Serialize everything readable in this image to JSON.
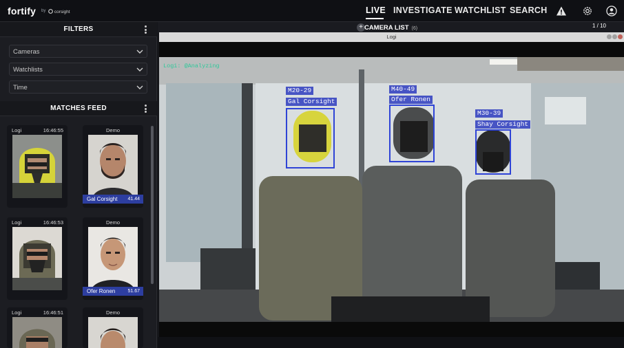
{
  "header": {
    "logo": "fortify",
    "logo_by": "by",
    "logo_partner": "corsight",
    "nav": [
      {
        "label": "LIVE",
        "active": true
      },
      {
        "label": "INVESTIGATE",
        "active": false
      },
      {
        "label": "WATCHLIST",
        "active": false
      },
      {
        "label": "SEARCH",
        "active": false
      }
    ],
    "icons": [
      "alert-icon",
      "settings-icon",
      "user-icon"
    ]
  },
  "filters": {
    "title": "FILTERS",
    "dropdowns": [
      {
        "label": "Cameras"
      },
      {
        "label": "Watchlists"
      },
      {
        "label": "Time"
      }
    ]
  },
  "feed": {
    "title": "MATCHES FEED",
    "items": [
      {
        "capture": {
          "camera": "Logi",
          "time": "16:46:55"
        },
        "match": {
          "camera": "Demo",
          "name": "Gal Corsight",
          "score": "41.44"
        }
      },
      {
        "capture": {
          "camera": "Logi",
          "time": "16:46:53"
        },
        "match": {
          "camera": "Demo",
          "name": "Ofer Ronen",
          "score": "51.67"
        }
      },
      {
        "capture": {
          "camera": "Logi",
          "time": "16:46:51"
        },
        "match": {
          "camera": "Demo",
          "name": "",
          "score": ""
        }
      }
    ]
  },
  "camera_list": {
    "title": "CAMERA LIST",
    "count": "(6)",
    "pager": "1 / 10",
    "window_title": "Logi",
    "overlay_text": "Logi: @Analyzing",
    "detections": [
      {
        "age": "M20-29",
        "name": "Gal Corsight"
      },
      {
        "age": "M40-49",
        "name": "Ofer Ronen"
      },
      {
        "age": "M30-39",
        "name": "Shay Corsight"
      }
    ]
  },
  "colors": {
    "accent": "#2e43d6",
    "overlay_green": "#2fc89a",
    "background": "#1c1d22"
  }
}
